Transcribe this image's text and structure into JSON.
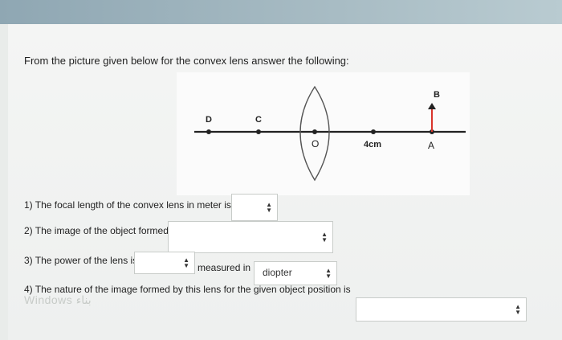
{
  "question": {
    "prompt": "From the picture given below for the convex lens answer the following:"
  },
  "figure": {
    "labels": {
      "D": "D",
      "C": "C",
      "O": "O",
      "distance": "4cm",
      "A": "A",
      "B": "B"
    }
  },
  "items": [
    {
      "text": "1) The focal length of the convex lens in meter is",
      "selected": ""
    },
    {
      "text": "2) The image of the object formed",
      "selected": ""
    },
    {
      "text": "3) The power of the lens is",
      "selected": "",
      "unit_text": "measured in",
      "unit_selected": "diopter"
    },
    {
      "text": "4) The nature of the image formed by this lens for the given object position is",
      "selected": ""
    }
  ],
  "watermark": "Windows بناء"
}
